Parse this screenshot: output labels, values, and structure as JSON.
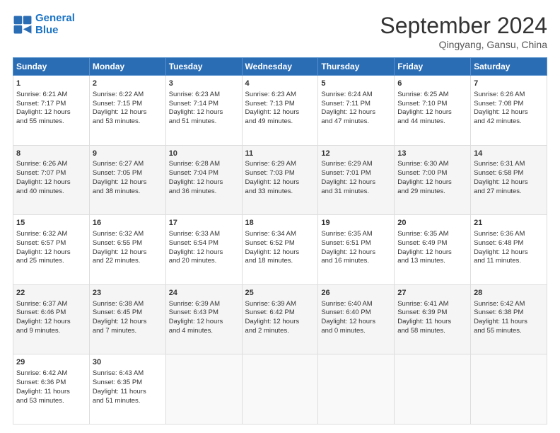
{
  "logo": {
    "line1": "General",
    "line2": "Blue"
  },
  "title": "September 2024",
  "location": "Qingyang, Gansu, China",
  "headers": [
    "Sunday",
    "Monday",
    "Tuesday",
    "Wednesday",
    "Thursday",
    "Friday",
    "Saturday"
  ],
  "weeks": [
    [
      {
        "day": "1",
        "lines": [
          "Sunrise: 6:21 AM",
          "Sunset: 7:17 PM",
          "Daylight: 12 hours",
          "and 55 minutes."
        ]
      },
      {
        "day": "2",
        "lines": [
          "Sunrise: 6:22 AM",
          "Sunset: 7:15 PM",
          "Daylight: 12 hours",
          "and 53 minutes."
        ]
      },
      {
        "day": "3",
        "lines": [
          "Sunrise: 6:23 AM",
          "Sunset: 7:14 PM",
          "Daylight: 12 hours",
          "and 51 minutes."
        ]
      },
      {
        "day": "4",
        "lines": [
          "Sunrise: 6:23 AM",
          "Sunset: 7:13 PM",
          "Daylight: 12 hours",
          "and 49 minutes."
        ]
      },
      {
        "day": "5",
        "lines": [
          "Sunrise: 6:24 AM",
          "Sunset: 7:11 PM",
          "Daylight: 12 hours",
          "and 47 minutes."
        ]
      },
      {
        "day": "6",
        "lines": [
          "Sunrise: 6:25 AM",
          "Sunset: 7:10 PM",
          "Daylight: 12 hours",
          "and 44 minutes."
        ]
      },
      {
        "day": "7",
        "lines": [
          "Sunrise: 6:26 AM",
          "Sunset: 7:08 PM",
          "Daylight: 12 hours",
          "and 42 minutes."
        ]
      }
    ],
    [
      {
        "day": "8",
        "lines": [
          "Sunrise: 6:26 AM",
          "Sunset: 7:07 PM",
          "Daylight: 12 hours",
          "and 40 minutes."
        ]
      },
      {
        "day": "9",
        "lines": [
          "Sunrise: 6:27 AM",
          "Sunset: 7:05 PM",
          "Daylight: 12 hours",
          "and 38 minutes."
        ]
      },
      {
        "day": "10",
        "lines": [
          "Sunrise: 6:28 AM",
          "Sunset: 7:04 PM",
          "Daylight: 12 hours",
          "and 36 minutes."
        ]
      },
      {
        "day": "11",
        "lines": [
          "Sunrise: 6:29 AM",
          "Sunset: 7:03 PM",
          "Daylight: 12 hours",
          "and 33 minutes."
        ]
      },
      {
        "day": "12",
        "lines": [
          "Sunrise: 6:29 AM",
          "Sunset: 7:01 PM",
          "Daylight: 12 hours",
          "and 31 minutes."
        ]
      },
      {
        "day": "13",
        "lines": [
          "Sunrise: 6:30 AM",
          "Sunset: 7:00 PM",
          "Daylight: 12 hours",
          "and 29 minutes."
        ]
      },
      {
        "day": "14",
        "lines": [
          "Sunrise: 6:31 AM",
          "Sunset: 6:58 PM",
          "Daylight: 12 hours",
          "and 27 minutes."
        ]
      }
    ],
    [
      {
        "day": "15",
        "lines": [
          "Sunrise: 6:32 AM",
          "Sunset: 6:57 PM",
          "Daylight: 12 hours",
          "and 25 minutes."
        ]
      },
      {
        "day": "16",
        "lines": [
          "Sunrise: 6:32 AM",
          "Sunset: 6:55 PM",
          "Daylight: 12 hours",
          "and 22 minutes."
        ]
      },
      {
        "day": "17",
        "lines": [
          "Sunrise: 6:33 AM",
          "Sunset: 6:54 PM",
          "Daylight: 12 hours",
          "and 20 minutes."
        ]
      },
      {
        "day": "18",
        "lines": [
          "Sunrise: 6:34 AM",
          "Sunset: 6:52 PM",
          "Daylight: 12 hours",
          "and 18 minutes."
        ]
      },
      {
        "day": "19",
        "lines": [
          "Sunrise: 6:35 AM",
          "Sunset: 6:51 PM",
          "Daylight: 12 hours",
          "and 16 minutes."
        ]
      },
      {
        "day": "20",
        "lines": [
          "Sunrise: 6:35 AM",
          "Sunset: 6:49 PM",
          "Daylight: 12 hours",
          "and 13 minutes."
        ]
      },
      {
        "day": "21",
        "lines": [
          "Sunrise: 6:36 AM",
          "Sunset: 6:48 PM",
          "Daylight: 12 hours",
          "and 11 minutes."
        ]
      }
    ],
    [
      {
        "day": "22",
        "lines": [
          "Sunrise: 6:37 AM",
          "Sunset: 6:46 PM",
          "Daylight: 12 hours",
          "and 9 minutes."
        ]
      },
      {
        "day": "23",
        "lines": [
          "Sunrise: 6:38 AM",
          "Sunset: 6:45 PM",
          "Daylight: 12 hours",
          "and 7 minutes."
        ]
      },
      {
        "day": "24",
        "lines": [
          "Sunrise: 6:39 AM",
          "Sunset: 6:43 PM",
          "Daylight: 12 hours",
          "and 4 minutes."
        ]
      },
      {
        "day": "25",
        "lines": [
          "Sunrise: 6:39 AM",
          "Sunset: 6:42 PM",
          "Daylight: 12 hours",
          "and 2 minutes."
        ]
      },
      {
        "day": "26",
        "lines": [
          "Sunrise: 6:40 AM",
          "Sunset: 6:40 PM",
          "Daylight: 12 hours",
          "and 0 minutes."
        ]
      },
      {
        "day": "27",
        "lines": [
          "Sunrise: 6:41 AM",
          "Sunset: 6:39 PM",
          "Daylight: 11 hours",
          "and 58 minutes."
        ]
      },
      {
        "day": "28",
        "lines": [
          "Sunrise: 6:42 AM",
          "Sunset: 6:38 PM",
          "Daylight: 11 hours",
          "and 55 minutes."
        ]
      }
    ],
    [
      {
        "day": "29",
        "lines": [
          "Sunrise: 6:42 AM",
          "Sunset: 6:36 PM",
          "Daylight: 11 hours",
          "and 53 minutes."
        ]
      },
      {
        "day": "30",
        "lines": [
          "Sunrise: 6:43 AM",
          "Sunset: 6:35 PM",
          "Daylight: 11 hours",
          "and 51 minutes."
        ]
      },
      {
        "day": "",
        "lines": []
      },
      {
        "day": "",
        "lines": []
      },
      {
        "day": "",
        "lines": []
      },
      {
        "day": "",
        "lines": []
      },
      {
        "day": "",
        "lines": []
      }
    ]
  ]
}
